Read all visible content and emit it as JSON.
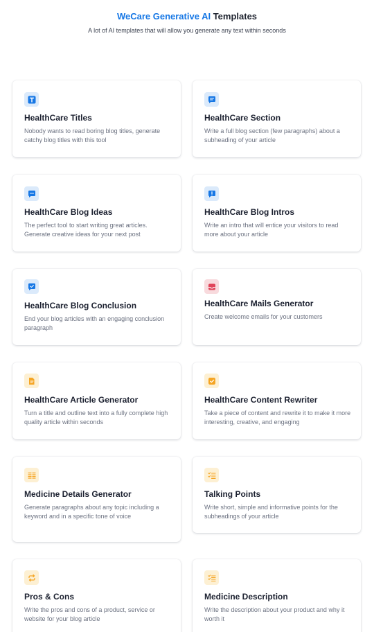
{
  "header": {
    "brand": "WeCare Generative AI",
    "title_rest": " Templates",
    "subtitle": "A lot of AI templates that will allow you generate any text within seconds"
  },
  "colors": {
    "brand": "#1677e5",
    "icon_blue_bg": "#dbeafb",
    "icon_red_bg": "#f8dadd",
    "icon_amber_bg": "#fdf0d3"
  },
  "templates": [
    {
      "title": "HealthCare Titles",
      "desc": "Nobody wants to read boring blog titles, generate catchy blog titles with this tool",
      "icon": "text-title-icon"
    },
    {
      "title": "HealthCare Section",
      "desc": "Write a full blog section (few paragraphs) about a subheading of your article",
      "icon": "message-icon"
    },
    {
      "title": "HealthCare Blog Ideas",
      "desc": "The perfect tool to start writing great articles. Generate creative ideas for your next post",
      "icon": "chat-dots-icon"
    },
    {
      "title": "HealthCare Blog Intros",
      "desc": "Write an intro that will entice your visitors to read more about your article",
      "icon": "chat-alert-icon"
    },
    {
      "title": "HealthCare Blog Conclusion",
      "desc": "End your blog articles with an engaging conclusion paragraph",
      "icon": "chat-check-icon"
    },
    {
      "title": "HealthCare Mails Generator",
      "desc": "Create welcome emails for your customers",
      "icon": "inbox-icon"
    },
    {
      "title": "HealthCare Article Generator",
      "desc": "Turn a title and outline text into a fully complete high quality article within seconds",
      "icon": "document-icon"
    },
    {
      "title": "HealthCare Content Rewriter",
      "desc": "Take a piece of content and rewrite it to make it more interesting, creative, and engaging",
      "icon": "checkbox-icon"
    },
    {
      "title": "Medicine Details Generator",
      "desc": "Generate paragraphs about any topic including a keyword and in a specific tone of voice",
      "icon": "columns-icon"
    },
    {
      "title": "Talking Points",
      "desc": "Write short, simple and informative points for the subheadings of your article",
      "icon": "checklist-icon"
    },
    {
      "title": "Pros & Cons",
      "desc": "Write the pros and cons of a product, service or website for your blog article",
      "icon": "repeat-icon"
    },
    {
      "title": "Medicine Description",
      "desc": "Write the description about your product and why it worth it",
      "icon": "list-check-icon"
    }
  ]
}
